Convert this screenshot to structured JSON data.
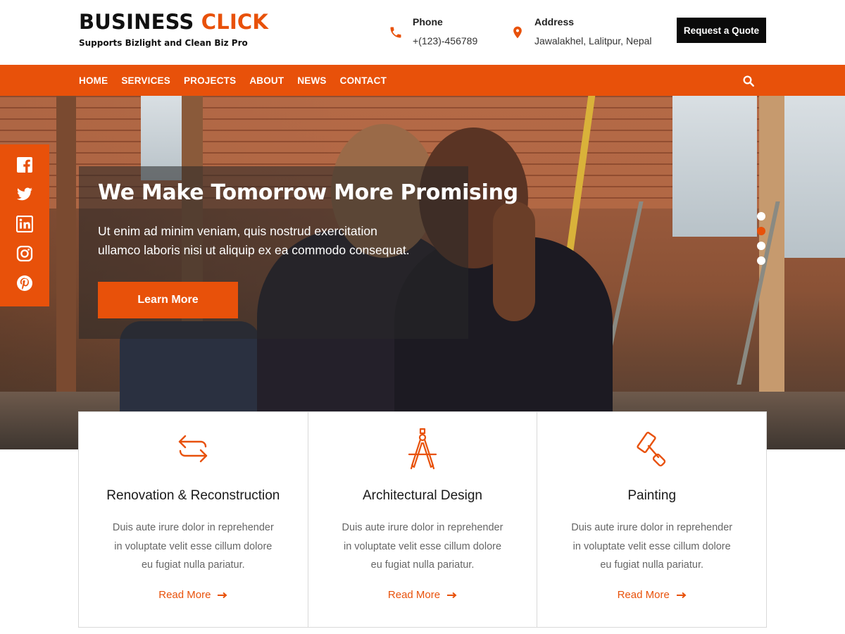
{
  "brand": {
    "title_main": "BUSINESS",
    "title_accent": "CLICK",
    "tagline": "Supports Bizlight and Clean Biz Pro"
  },
  "contact": {
    "phone_label": "Phone",
    "phone_value": "+(123)-456789",
    "address_label": "Address",
    "address_value": "Jawalakhel, Lalitpur, Nepal"
  },
  "header": {
    "quote_button": "Request a Quote"
  },
  "nav": {
    "items": [
      "HOME",
      "SERVICES",
      "PROJECTS",
      "ABOUT",
      "NEWS",
      "CONTACT"
    ],
    "search_icon": "search-icon"
  },
  "hero": {
    "title": "We Make Tomorrow More Promising",
    "text_line1": "Ut enim ad minim veniam, quis nostrud exercitation",
    "text_line2": "ullamco laboris nisi ut aliquip ex ea commodo consequat.",
    "button": "Learn More",
    "slides": 4,
    "active_slide": 2
  },
  "social": [
    "facebook-icon",
    "twitter-icon",
    "linkedin-icon",
    "instagram-icon",
    "pinterest-icon"
  ],
  "services": [
    {
      "icon": "swap-arrows-icon",
      "title": "Renovation & Reconstruction",
      "desc_line1": "Duis aute irure dolor in reprehender",
      "desc_line2": "in voluptate velit esse cillum dolore",
      "desc_line3": "eu fugiat nulla pariatur.",
      "link": "Read More"
    },
    {
      "icon": "drafting-compass-icon",
      "title": "Architectural Design",
      "desc_line1": "Duis aute irure dolor in reprehender",
      "desc_line2": "in voluptate velit esse cillum dolore",
      "desc_line3": "eu fugiat nulla pariatur.",
      "link": "Read More"
    },
    {
      "icon": "paint-roller-icon",
      "title": "Painting",
      "desc_line1": "Duis aute irure dolor in reprehender",
      "desc_line2": "in voluptate velit esse cillum dolore",
      "desc_line3": "eu fugiat nulla pariatur.",
      "link": "Read More"
    }
  ],
  "colors": {
    "accent": "#e8510a",
    "dark": "#0a0a0a",
    "text_muted": "#666666"
  }
}
